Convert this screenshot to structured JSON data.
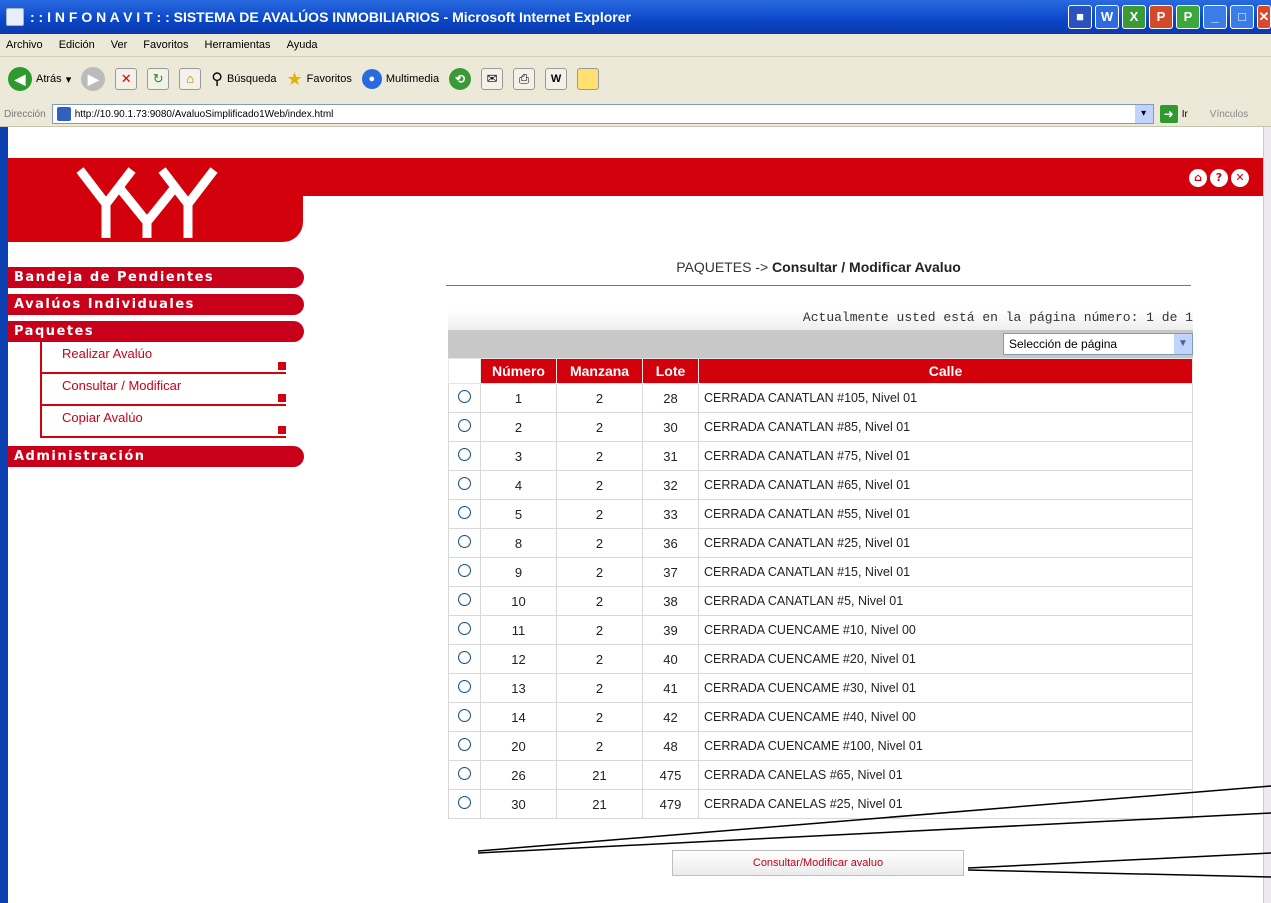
{
  "window": {
    "title": ": : I N F O N A V I T : : SISTEMA DE AVALÚOS INMOBILIARIOS - Microsoft Internet Explorer",
    "controls": [
      "min",
      "max",
      "close"
    ]
  },
  "menubar": [
    "Archivo",
    "Edición",
    "Ver",
    "Favoritos",
    "Herramientas",
    "Ayuda"
  ],
  "toolbar": {
    "back_label": "Atrás",
    "search_label": "Búsqueda",
    "favorites_label": "Favoritos",
    "media_label": "Multimedia"
  },
  "address": {
    "label": "Dirección",
    "url": "http://10.90.1.73:9080/AvaluoSimplificado1Web/index.html",
    "go_label": "Ir",
    "links_label": "Vínculos"
  },
  "logo": {
    "text": "INFONAVIT"
  },
  "nav": {
    "items": [
      {
        "label": "Bandeja de Pendientes"
      },
      {
        "label": "Avalúos Individuales"
      },
      {
        "label": "Paquetes"
      }
    ],
    "subitems": [
      {
        "label": "Realizar Avalúo"
      },
      {
        "label": "Consultar / Modificar"
      },
      {
        "label": "Copiar Avalúo"
      }
    ],
    "admin": {
      "label": "Administración"
    }
  },
  "main": {
    "breadcrumb_prefix": "PAQUETES ->",
    "breadcrumb_current": "Consultar / Modificar Avaluo",
    "page_info": "Actualmente usted está en la página número: 1 de 1",
    "page_select": "Selección de página",
    "submit_label": "Consultar/Modificar avaluo"
  },
  "table": {
    "headers": [
      "Número",
      "Manzana",
      "Lote",
      "Calle"
    ],
    "rows": [
      {
        "numero": "1",
        "manzana": "2",
        "lote": "28",
        "calle": "CERRADA CANATLAN #105, Nivel 01"
      },
      {
        "numero": "2",
        "manzana": "2",
        "lote": "30",
        "calle": "CERRADA CANATLAN #85, Nivel 01"
      },
      {
        "numero": "3",
        "manzana": "2",
        "lote": "31",
        "calle": "CERRADA CANATLAN #75, Nivel 01"
      },
      {
        "numero": "4",
        "manzana": "2",
        "lote": "32",
        "calle": "CERRADA CANATLAN #65, Nivel 01"
      },
      {
        "numero": "5",
        "manzana": "2",
        "lote": "33",
        "calle": "CERRADA CANATLAN #55, Nivel 01"
      },
      {
        "numero": "8",
        "manzana": "2",
        "lote": "36",
        "calle": "CERRADA CANATLAN #25, Nivel 01"
      },
      {
        "numero": "9",
        "manzana": "2",
        "lote": "37",
        "calle": "CERRADA CANATLAN #15, Nivel 01"
      },
      {
        "numero": "10",
        "manzana": "2",
        "lote": "38",
        "calle": "CERRADA CANATLAN #5, Nivel 01"
      },
      {
        "numero": "11",
        "manzana": "2",
        "lote": "39",
        "calle": "CERRADA CUENCAME #10, Nivel 00"
      },
      {
        "numero": "12",
        "manzana": "2",
        "lote": "40",
        "calle": "CERRADA CUENCAME #20, Nivel 01"
      },
      {
        "numero": "13",
        "manzana": "2",
        "lote": "41",
        "calle": "CERRADA CUENCAME #30, Nivel 01"
      },
      {
        "numero": "14",
        "manzana": "2",
        "lote": "42",
        "calle": "CERRADA CUENCAME #40, Nivel 00"
      },
      {
        "numero": "20",
        "manzana": "2",
        "lote": "48",
        "calle": "CERRADA CUENCAME #100, Nivel 01"
      },
      {
        "numero": "26",
        "manzana": "21",
        "lote": "475",
        "calle": "CERRADA CANELAS #65, Nivel 01"
      },
      {
        "numero": "30",
        "manzana": "21",
        "lote": "479",
        "calle": "CERRADA CANELAS #25, Nivel 01"
      }
    ]
  },
  "colors": {
    "brand_red": "#d3010c",
    "xp_blue": "#0a46c8"
  }
}
